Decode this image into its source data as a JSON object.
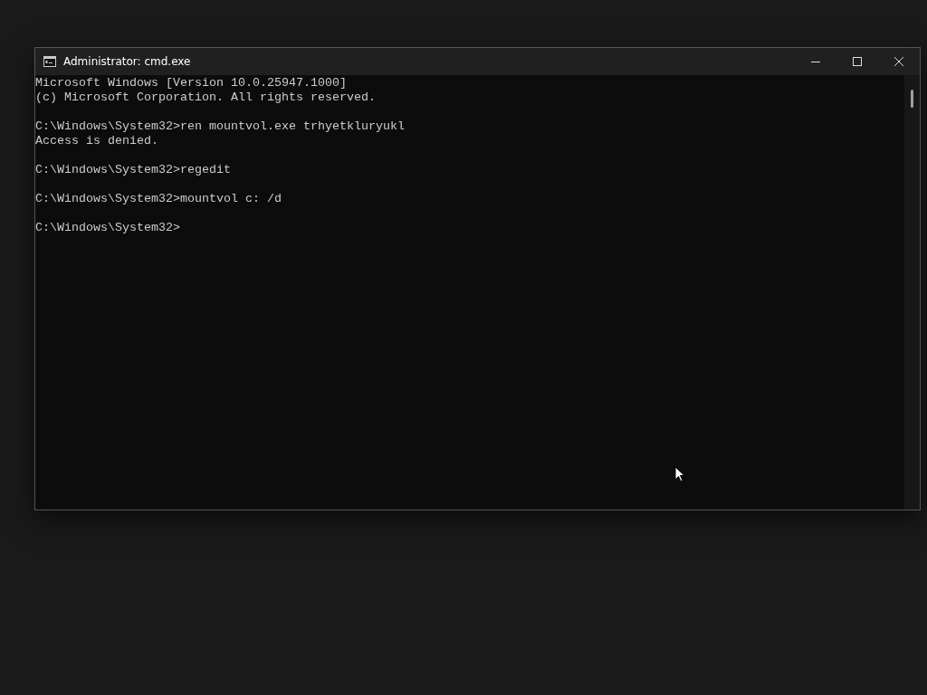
{
  "window": {
    "title": "Administrator: cmd.exe"
  },
  "console": {
    "blocks": [
      [
        "Microsoft Windows [Version 10.0.25947.1000]",
        "(c) Microsoft Corporation. All rights reserved."
      ],
      [
        "C:\\Windows\\System32>ren mountvol.exe trhyetkluryukl",
        "Access is denied."
      ],
      [
        "C:\\Windows\\System32>regedit"
      ],
      [
        "C:\\Windows\\System32>mountvol c: /d"
      ],
      [
        "C:\\Windows\\System32>"
      ]
    ]
  }
}
